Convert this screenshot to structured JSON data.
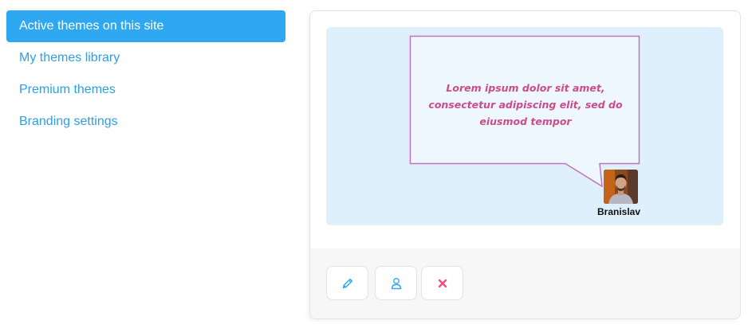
{
  "sidebar": {
    "items": [
      {
        "label": "Active themes on this site",
        "active": true
      },
      {
        "label": "My themes library",
        "active": false
      },
      {
        "label": "Premium themes",
        "active": false
      },
      {
        "label": "Branding settings",
        "active": false
      }
    ]
  },
  "theme_card": {
    "preview": {
      "bubble_text": "Lorem ipsum dolor sit amet, consectetur adipiscing elit, sed do eiusmod tempor",
      "author_name": "Branislav"
    },
    "actions": [
      {
        "icon": "pencil-icon"
      },
      {
        "icon": "user-icon"
      },
      {
        "icon": "close-icon"
      }
    ]
  },
  "colors": {
    "accent": "#2fa8f2",
    "link": "#2f9fe4",
    "bubble_text": "#cc4b8d",
    "bubble_border": "#c275b7",
    "preview_bg": "#ddf0fb",
    "delete": "#f0527a"
  }
}
